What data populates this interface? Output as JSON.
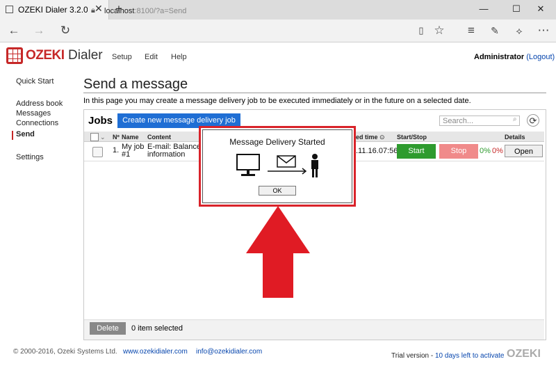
{
  "browser": {
    "tab_title": "OZEKI Dialer 3.2.0 (192.",
    "url_host": "localhost",
    "url_rest": ":8100/?a=Send"
  },
  "app": {
    "logo_brand": "OZEKI",
    "logo_product": "Dialer",
    "menu": [
      "Setup",
      "Edit",
      "Help"
    ],
    "user": "Administrator",
    "logout_label": "(Logout)"
  },
  "sidebar": {
    "items": [
      "Quick Start",
      "Address book",
      "Messages",
      "Connections",
      "Send",
      "Settings"
    ],
    "active": "Send"
  },
  "main": {
    "title": "Send a message",
    "description": "In this page you may create a message delivery job to be executed immediately or in the future on a selected date.",
    "jobs_title": "Jobs",
    "create_button": "Create new message delivery job",
    "search_placeholder": "Search...",
    "columns": {
      "no": "Nº",
      "name": "Name",
      "content": "Content",
      "scheduled": "ed time",
      "start_stop": "Start/Stop",
      "details": "Details"
    },
    "rows": [
      {
        "no": "1.",
        "name_line1": "My job",
        "name_line2": "#1",
        "content_line1": "E-mail: Balance",
        "content_line2": "information",
        "scheduled": ".11.16.07:56",
        "start_label": "Start",
        "stop_label": "Stop",
        "progress_a": "0%",
        "progress_b": "0%",
        "open_label": "Open"
      }
    ],
    "delete_button": "Delete",
    "selection_text": "0 item selected"
  },
  "footer": {
    "copyright": "© 2000-2016, Ozeki Systems Ltd.",
    "website": "www.ozekidialer.com",
    "email": "info@ozekidialer.com",
    "trial_prefix": "Trial version - ",
    "trial_link": "10 days left to activate",
    "logo": "OZEKI"
  },
  "popup": {
    "title": "Message Delivery Started",
    "ok_label": "OK"
  },
  "colors": {
    "brand_red": "#c62828",
    "primary_blue": "#1f6ed4",
    "start_green": "#2e9b2e",
    "stop_pink": "#f08a8a",
    "highlight_red": "#d9232a"
  }
}
